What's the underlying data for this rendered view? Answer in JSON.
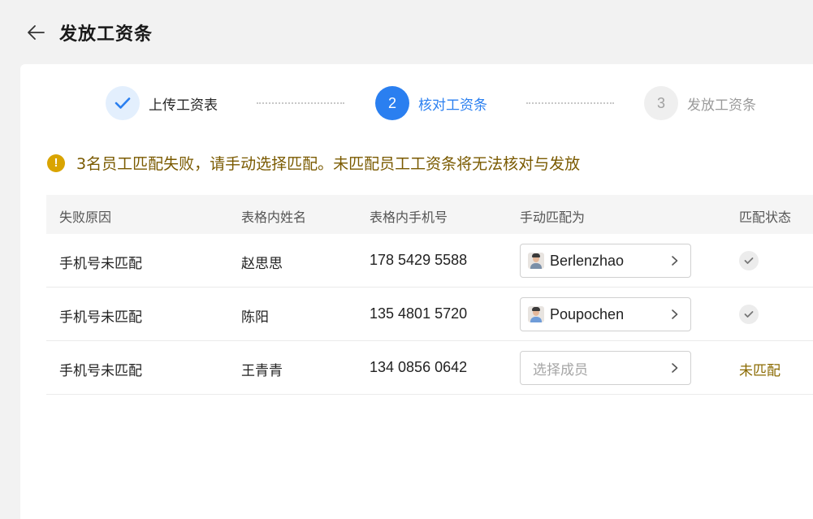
{
  "header": {
    "title": "发放工资条"
  },
  "steps": [
    {
      "index": "1",
      "label": "上传工资表",
      "state": "done"
    },
    {
      "index": "2",
      "label": "核对工资条",
      "state": "active"
    },
    {
      "index": "3",
      "label": "发放工资条",
      "state": "pending"
    }
  ],
  "warning": {
    "icon": "warning-icon",
    "text": "3名员工匹配失败，请手动选择匹配。未匹配员工工资条将无法核对与发放",
    "color": "#d9a400"
  },
  "table": {
    "columns": [
      "失败原因",
      "表格内姓名",
      "表格内手机号",
      "手动匹配为",
      "匹配状态"
    ],
    "rows": [
      {
        "reason": "手机号未匹配",
        "name": "赵思思",
        "phone": "178 5429 5588",
        "match": "Berlenzhao",
        "status": "matched"
      },
      {
        "reason": "手机号未匹配",
        "name": "陈阳",
        "phone": "135 4801 5720",
        "match": "Poupochen",
        "status": "matched"
      },
      {
        "reason": "手机号未匹配",
        "name": "王青青",
        "phone": "134 0856 0642",
        "match_placeholder": "选择成员",
        "status": "未匹配"
      }
    ]
  },
  "colors": {
    "accent": "#2a7ff0",
    "warning_text": "#7a5a00"
  }
}
